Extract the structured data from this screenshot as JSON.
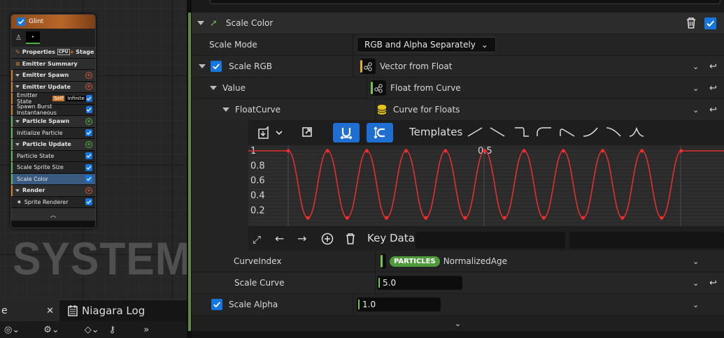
{
  "emitter_node": {
    "title": "Glint",
    "thumb_label": "•",
    "properties_label": "Properties",
    "cpu_label": "CPU",
    "stage_label": "Stage",
    "emitter_summary_label": "Emitter Summary",
    "rows": [
      {
        "label": "Emitter Spawn",
        "kind": "section-plus",
        "accent": "orange"
      },
      {
        "label": "Emitter Update",
        "kind": "section-plus",
        "accent": "orange"
      },
      {
        "label": "Emitter State",
        "kind": "item",
        "accent": "orange",
        "badge_self": "Self",
        "badge_inf": "Infinite"
      },
      {
        "label": "Spawn Burst Instantaneous",
        "kind": "item",
        "accent": "orange"
      },
      {
        "label": "Particle Spawn",
        "kind": "section-plus",
        "accent": "green"
      },
      {
        "label": "Initialize Particle",
        "kind": "item",
        "accent": "green"
      },
      {
        "label": "Particle Update",
        "kind": "section-plus",
        "accent": "green"
      },
      {
        "label": "Particle State",
        "kind": "item",
        "accent": "green"
      },
      {
        "label": "Scale Sprite Size",
        "kind": "item",
        "accent": "green"
      },
      {
        "label": "Scale Color",
        "kind": "item",
        "accent": "green",
        "selected": true
      },
      {
        "label": "Render",
        "kind": "section-plus",
        "accent": "orange"
      },
      {
        "label": "Sprite Renderer",
        "kind": "item",
        "accent": "none"
      }
    ],
    "footer_icon": "chevron-up-icon"
  },
  "watermark": "SYSTEM",
  "bottom_tabs": {
    "left_tab_label": "e",
    "niagara_log_label": "Niagara Log"
  },
  "details": {
    "module_title": "Scale Color",
    "rows": {
      "scale_mode": {
        "label": "Scale Mode",
        "value": "RGB and Alpha Separately"
      },
      "scale_rgb": {
        "label": "Scale RGB",
        "value": "Vector from Float"
      },
      "value": {
        "label": "Value",
        "value": "Float from Curve"
      },
      "float_curve": {
        "label": "FloatCurve",
        "value": "Curve for Floats"
      },
      "curve_index": {
        "label": "CurveIndex",
        "badge": "PARTICLES",
        "value": "NormalizedAge"
      },
      "scale_curve": {
        "label": "Scale Curve",
        "value": "5.0"
      },
      "scale_alpha": {
        "label": "Scale Alpha",
        "value": "1.0"
      }
    },
    "curve_editor": {
      "templates_label": "Templates",
      "key_data_label": "Key Data",
      "y_ticks": [
        "1",
        "0.8",
        "0.6",
        "0.4",
        "0.2"
      ],
      "x_tick_mid": "0.5",
      "curve_color": "#e03030",
      "key_color": "#ff2a2a"
    }
  },
  "colors": {
    "accent_blue": "#1676e0",
    "emitter_header": "#b86628",
    "module_green": "#5e8a46"
  }
}
